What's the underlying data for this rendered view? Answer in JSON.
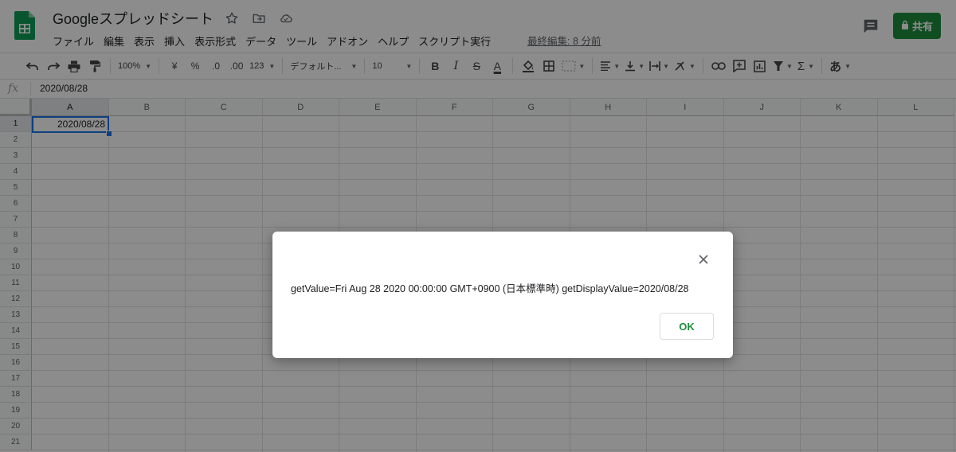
{
  "app": {
    "title": "Googleスプレッドシート",
    "last_edit": "最終編集: 8 分前",
    "share_label": "共有",
    "accent": "#1e8e3e"
  },
  "menu": [
    "ファイル",
    "編集",
    "表示",
    "挿入",
    "表示形式",
    "データ",
    "ツール",
    "アドオン",
    "ヘルプ",
    "スクリプト実行"
  ],
  "toolbar": {
    "zoom": "100%",
    "currency": "¥",
    "percent": "%",
    "dec_decrease": ".0",
    "dec_increase": ".00",
    "more_formats": "123",
    "font": "デフォルト...",
    "font_size": "10",
    "bold": "B",
    "italic": "I",
    "strike": "S",
    "text_color": "A",
    "input_tools": "あ"
  },
  "formula_bar": {
    "fx": "fx",
    "value": "2020/08/28"
  },
  "grid": {
    "columns": [
      "A",
      "B",
      "C",
      "D",
      "E",
      "F",
      "G",
      "H",
      "I",
      "J",
      "K",
      "L"
    ],
    "rows": [
      "1",
      "2",
      "3",
      "4",
      "5",
      "6",
      "7",
      "8",
      "9",
      "10",
      "11",
      "12",
      "13",
      "14",
      "15",
      "16",
      "17",
      "18",
      "19",
      "20",
      "21"
    ],
    "a1": "2020/08/28"
  },
  "dialog": {
    "message": "getValue=Fri Aug 28 2020 00:00:00 GMT+0900 (日本標準時) getDisplayValue=2020/08/28",
    "ok_label": "OK"
  }
}
